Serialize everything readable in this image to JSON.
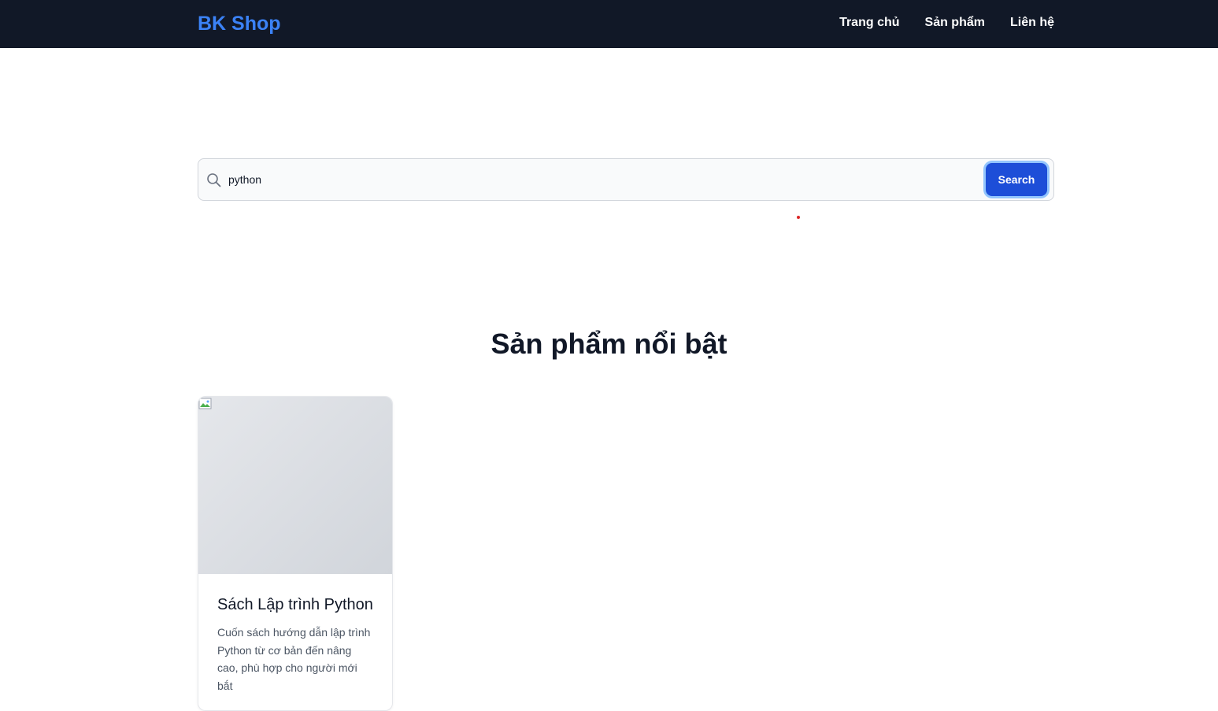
{
  "nav": {
    "brand": "BK Shop",
    "links": [
      "Trang chủ",
      "Sản phẩm",
      "Liên hệ"
    ]
  },
  "search": {
    "value": "python",
    "button_label": "Search"
  },
  "featured": {
    "title": "Sản phẩm nổi bật",
    "products": [
      {
        "name": "Sách Lập trình Python",
        "description": "Cuốn sách hướng dẫn lập trình Python từ cơ bản đến nâng cao, phù hợp cho người mới bắt"
      }
    ]
  },
  "colors": {
    "navbar_bg": "#111827",
    "brand": "#3b82f6",
    "button": "#1d4ed8"
  }
}
